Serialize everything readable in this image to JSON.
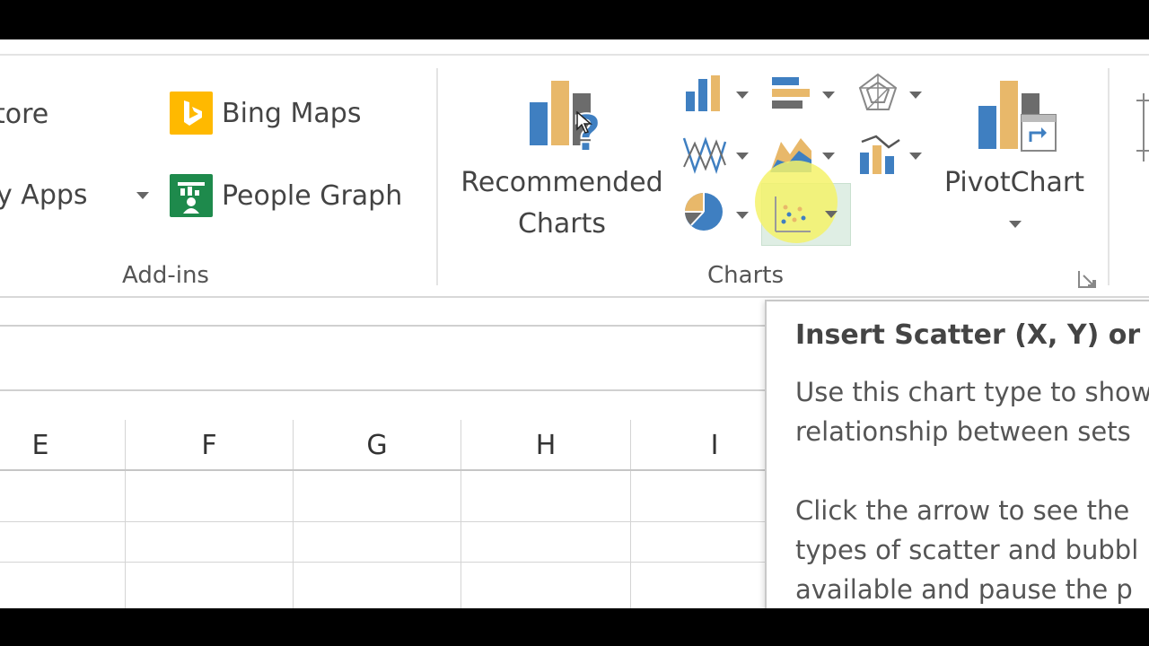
{
  "ribbon": {
    "addins": {
      "store_label": "Store",
      "store_visible": "tore",
      "bing_maps_label": "Bing Maps",
      "my_apps_label": "My Apps",
      "my_apps_visible": "y Apps",
      "people_graph_label": "People Graph",
      "group_label": "Add-ins"
    },
    "charts": {
      "recommended_line1": "Recommended",
      "recommended_line2": "Charts",
      "pivotchart_label": "PivotChart",
      "group_label": "Charts"
    }
  },
  "sheet": {
    "columns": [
      "E",
      "F",
      "G",
      "H",
      "I"
    ]
  },
  "tooltip": {
    "title": "Insert Scatter (X, Y) or B",
    "line1": "Use this chart type to show",
    "line2": "relationship between sets",
    "line3": "Click the arrow to see the",
    "line4": "types of scatter and bubbl",
    "line5": "available and pause the p"
  },
  "colors": {
    "accent_blue": "#3f7fc1",
    "accent_orange": "#e8b86a",
    "bing_yellow": "#ffb900",
    "people_green": "#1e8a4c",
    "highlight_yellow": "#f4f26a"
  }
}
